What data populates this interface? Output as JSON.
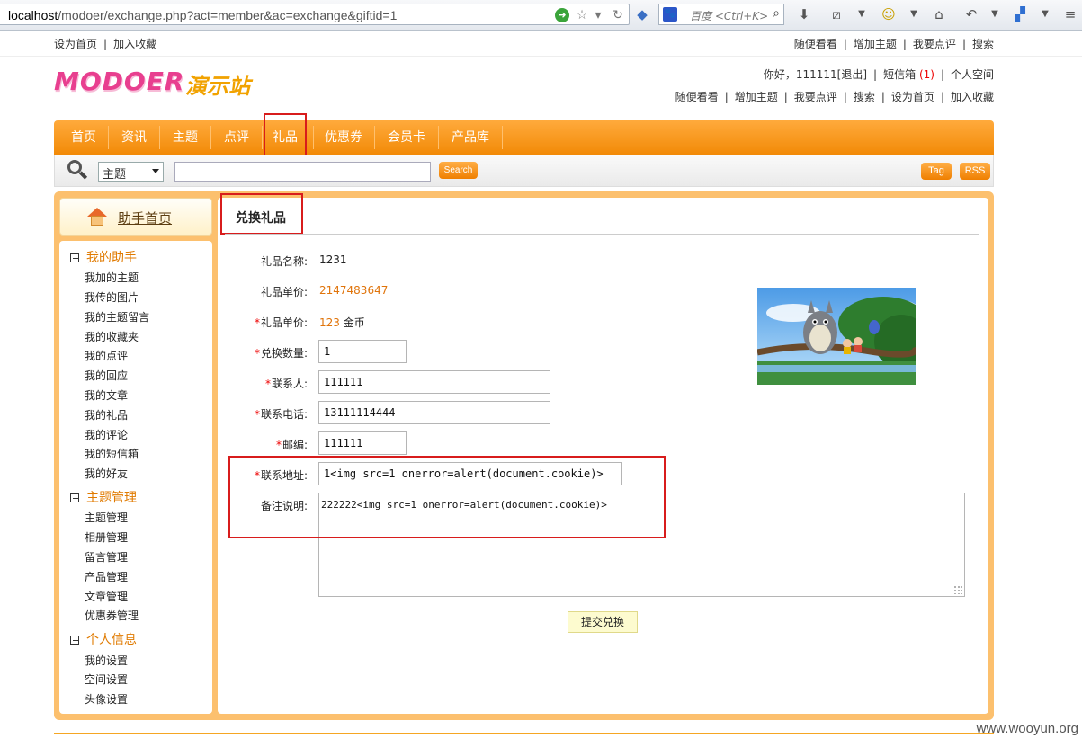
{
  "browser": {
    "url_host": "localhost",
    "url_rest": "/modoer/exchange.php?act=member&ac=exchange&giftid=1",
    "search_placeholder": "百度 <Ctrl+K>"
  },
  "topbar": {
    "left": [
      "设为首页",
      "加入收藏"
    ],
    "right": [
      "随便看看",
      "增加主题",
      "我要点评",
      "搜索"
    ]
  },
  "logo": {
    "en": "MODOER",
    "cn": "演示站"
  },
  "user": {
    "greeting": "你好，",
    "name": "111111",
    "logout": "[退出]",
    "inbox": "短信箱",
    "inbox_count": "(1)",
    "space": "个人空间"
  },
  "header_links": [
    "随便看看",
    "增加主题",
    "我要点评",
    "搜索",
    "设为首页",
    "加入收藏"
  ],
  "nav": [
    "首页",
    "资讯",
    "主题",
    "点评",
    "礼品",
    "优惠券",
    "会员卡",
    "产品库"
  ],
  "search": {
    "select_value": "主题",
    "button": "Search",
    "tag": "Tag",
    "rss": "RSS"
  },
  "sidebar": {
    "home": "助手首页",
    "groups": [
      {
        "title": "我的助手",
        "items": [
          "我加的主题",
          "我传的图片",
          "我的主题留言",
          "我的收藏夹",
          "我的点评",
          "我的回应",
          "我的文章",
          "我的礼品",
          "我的评论",
          "我的短信箱",
          "我的好友"
        ]
      },
      {
        "title": "主题管理",
        "items": [
          "主题管理",
          "相册管理",
          "留言管理",
          "产品管理",
          "文章管理",
          "优惠券管理"
        ]
      },
      {
        "title": "个人信息",
        "items": [
          "我的设置",
          "空间设置",
          "头像设置"
        ]
      }
    ]
  },
  "form": {
    "title": "兑换礼品",
    "gift_name_label": "礼品名称:",
    "gift_name": "1231",
    "unit_price_label": "礼品单价:",
    "unit_price": "2147483647",
    "unit_price2_label": "礼品单价:",
    "unit_price2": "123",
    "unit_price2_suffix": "金币",
    "qty_label": "兑换数量:",
    "qty": "1",
    "contact_label": "联系人:",
    "contact": "111111",
    "phone_label": "联系电话:",
    "phone": "13111114444",
    "zip_label": "邮编:",
    "zip": "111111",
    "address_label": "联系地址:",
    "address": "1<img src=1 onerror=alert(document.cookie)>",
    "note_label": "备注说明:",
    "note": "222222<img src=1 onerror=alert(document.cookie)>",
    "submit": "提交兑换"
  },
  "watermark": "www.wooyun.org",
  "colors": {
    "nav_orange": "#f28a07",
    "highlight_red": "#d81c1c",
    "price_orange": "#e0740b"
  }
}
